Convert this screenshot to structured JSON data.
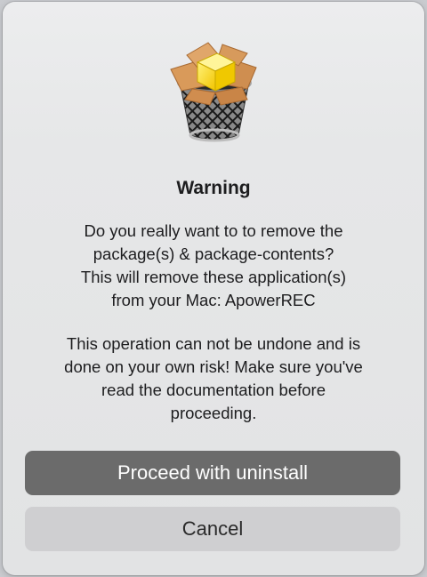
{
  "dialog": {
    "icon": "trash-box-icon",
    "title": "Warning",
    "message_lines": [
      "Do you really want to to remove the",
      "package(s) & package-contents?",
      "This will remove these application(s)",
      "from your Mac: ApowerREC"
    ],
    "warning_lines": [
      "This operation can not be undone and is",
      "done on your own risk! Make sure you've",
      "read the documentation before",
      "proceeding."
    ],
    "proceed_label": "Proceed with uninstall",
    "cancel_label": "Cancel"
  },
  "colors": {
    "primary_button": "#6b6b6b",
    "secondary_button": "#cfcfd1",
    "box_yellow": "#f5d21e",
    "box_cardboard": "#d79a5c"
  }
}
